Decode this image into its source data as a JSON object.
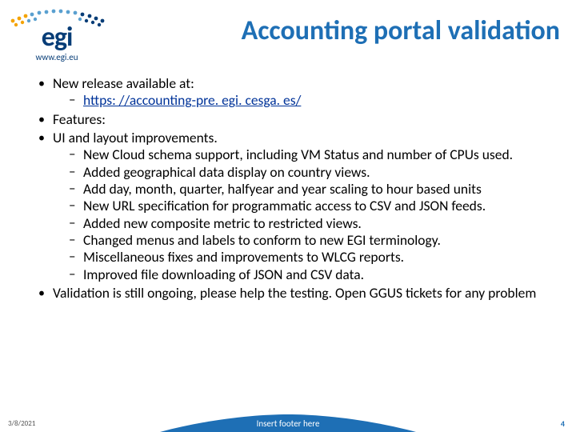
{
  "logo": {
    "text": "egi",
    "url": "www.egi.eu"
  },
  "title": "Accounting portal validation",
  "bullets": {
    "b1": "New release available at:",
    "b1_link": " https: //accounting-pre. egi. cesga. es/",
    "b2": "Features:",
    "b3": "UI and layout improvements.",
    "s1": "New Cloud schema support, including VM Status and number of CPUs used.",
    "s2": "Added geographical data display on country views.",
    "s3": "Add day, month, quarter, halfyear and year scaling to hour based units",
    "s4": "New URL specification for programmatic access to CSV and JSON feeds.",
    "s5": "Added new composite metric to restricted views.",
    "s6": "Changed menus and labels to conform to new EGI terminology.",
    "s7": "Miscellaneous fixes and improvements to WLCG reports.",
    "s8": "Improved file downloading of JSON and CSV data.",
    "b4": "Validation is still ongoing, please help the testing. Open GGUS tickets for any problem"
  },
  "footer": {
    "date": "3/8/2021",
    "center": "Insert footer here",
    "page": "4"
  },
  "colors": {
    "title": "#1e6fb5",
    "brand": "#073d77",
    "footer_fill": "#1e6fb5"
  }
}
